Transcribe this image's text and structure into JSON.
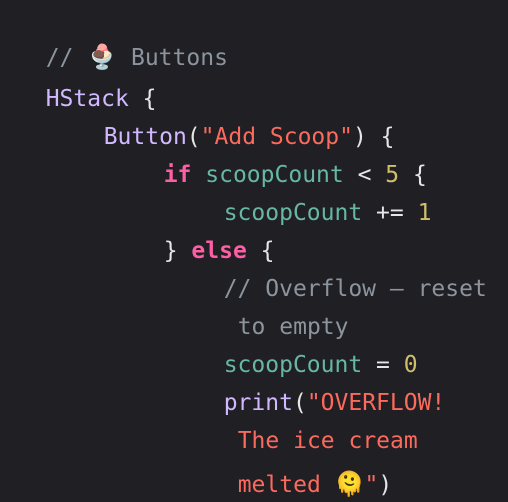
{
  "code": {
    "l1": {
      "comment_prefix": "// ",
      "emoji": "🍨",
      "comment_text": " Buttons"
    },
    "l2": {
      "type": "HStack",
      "brace": " {"
    },
    "l3": {
      "func": "Button",
      "open": "(",
      "string": "\"Add Scoop\"",
      "close": ") {"
    },
    "l4": {
      "keyword": "if",
      "sp": " ",
      "var": "scoopCount",
      "op": " < ",
      "num": "5",
      "brace": " {"
    },
    "l5": {
      "var": "scoopCount",
      "op": " += ",
      "num": "1"
    },
    "l6": {
      "brace_close": "} ",
      "keyword": "else",
      "brace": " {"
    },
    "l7": {
      "comment": "// Overflow — reset"
    },
    "l8": {
      "comment": "to empty"
    },
    "l9": {
      "var": "scoopCount",
      "op": " = ",
      "num": "0"
    },
    "l10": {
      "func": "print",
      "open": "(",
      "string": "\"OVERFLOW!"
    },
    "l11": {
      "string": "The ice cream"
    },
    "l12": {
      "string": "melted ",
      "emoji": "🫠",
      "string_end": "\"",
      "close": ")"
    }
  }
}
